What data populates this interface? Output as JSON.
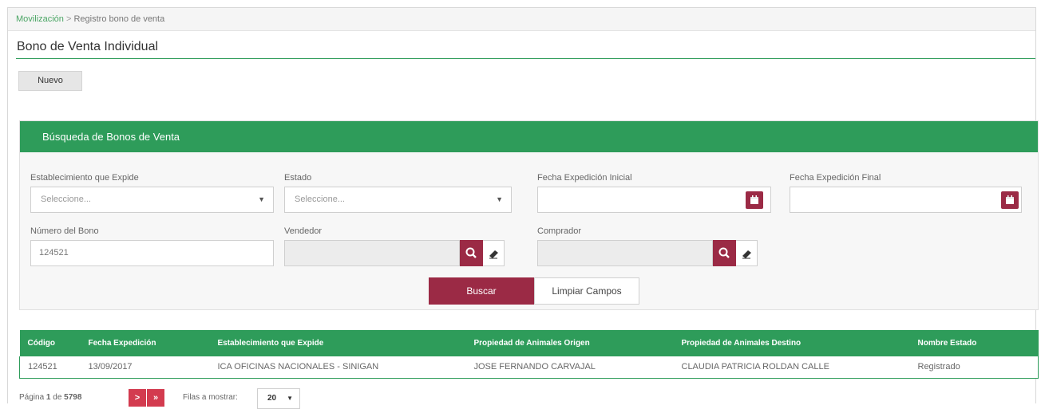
{
  "breadcrumb": {
    "parent": "Movilización",
    "separator": ">",
    "current": "Registro bono de venta"
  },
  "page_title": "Bono de Venta Individual",
  "toolbar": {
    "new_label": "Nuevo"
  },
  "search_panel": {
    "title": "Búsqueda de Bonos de Venta",
    "establecimiento": {
      "label": "Establecimiento que Expide",
      "value": "Seleccione..."
    },
    "estado": {
      "label": "Estado",
      "value": "Seleccione..."
    },
    "fecha_inicial": {
      "label": "Fecha Expedición Inicial",
      "value": ""
    },
    "fecha_final": {
      "label": "Fecha Expedición Final",
      "value": ""
    },
    "numero_bono": {
      "label": "Número del Bono",
      "value": "124521"
    },
    "vendedor": {
      "label": "Vendedor",
      "value": ""
    },
    "comprador": {
      "label": "Comprador",
      "value": ""
    },
    "search_label": "Buscar",
    "clear_label": "Limpiar Campos"
  },
  "table": {
    "columns": [
      "Código",
      "Fecha Expedición",
      "Establecimiento que Expide",
      "Propiedad de Animales Origen",
      "Propiedad de Animales Destino",
      "Nombre Estado"
    ],
    "rows": [
      [
        "124521",
        "13/09/2017",
        "ICA OFICINAS NACIONALES - SINIGAN",
        "JOSE FERNANDO CARVAJAL",
        "CLAUDIA PATRICIA ROLDAN CALLE",
        "Registrado"
      ]
    ]
  },
  "pagination": {
    "page_prefix": "Página",
    "current_page": "1",
    "of_label": "de",
    "total_pages": "5798",
    "next_label": ">",
    "last_label": "»",
    "rows_label": "Filas a mostrar:",
    "rows_value": "20"
  },
  "colors": {
    "primary_green": "#2e9c5a",
    "accent_maroon": "#9b2a45",
    "pager_red": "#d33b4f"
  },
  "icons": [
    "calendar-icon",
    "search-icon",
    "eraser-icon",
    "chevron-down-icon"
  ]
}
